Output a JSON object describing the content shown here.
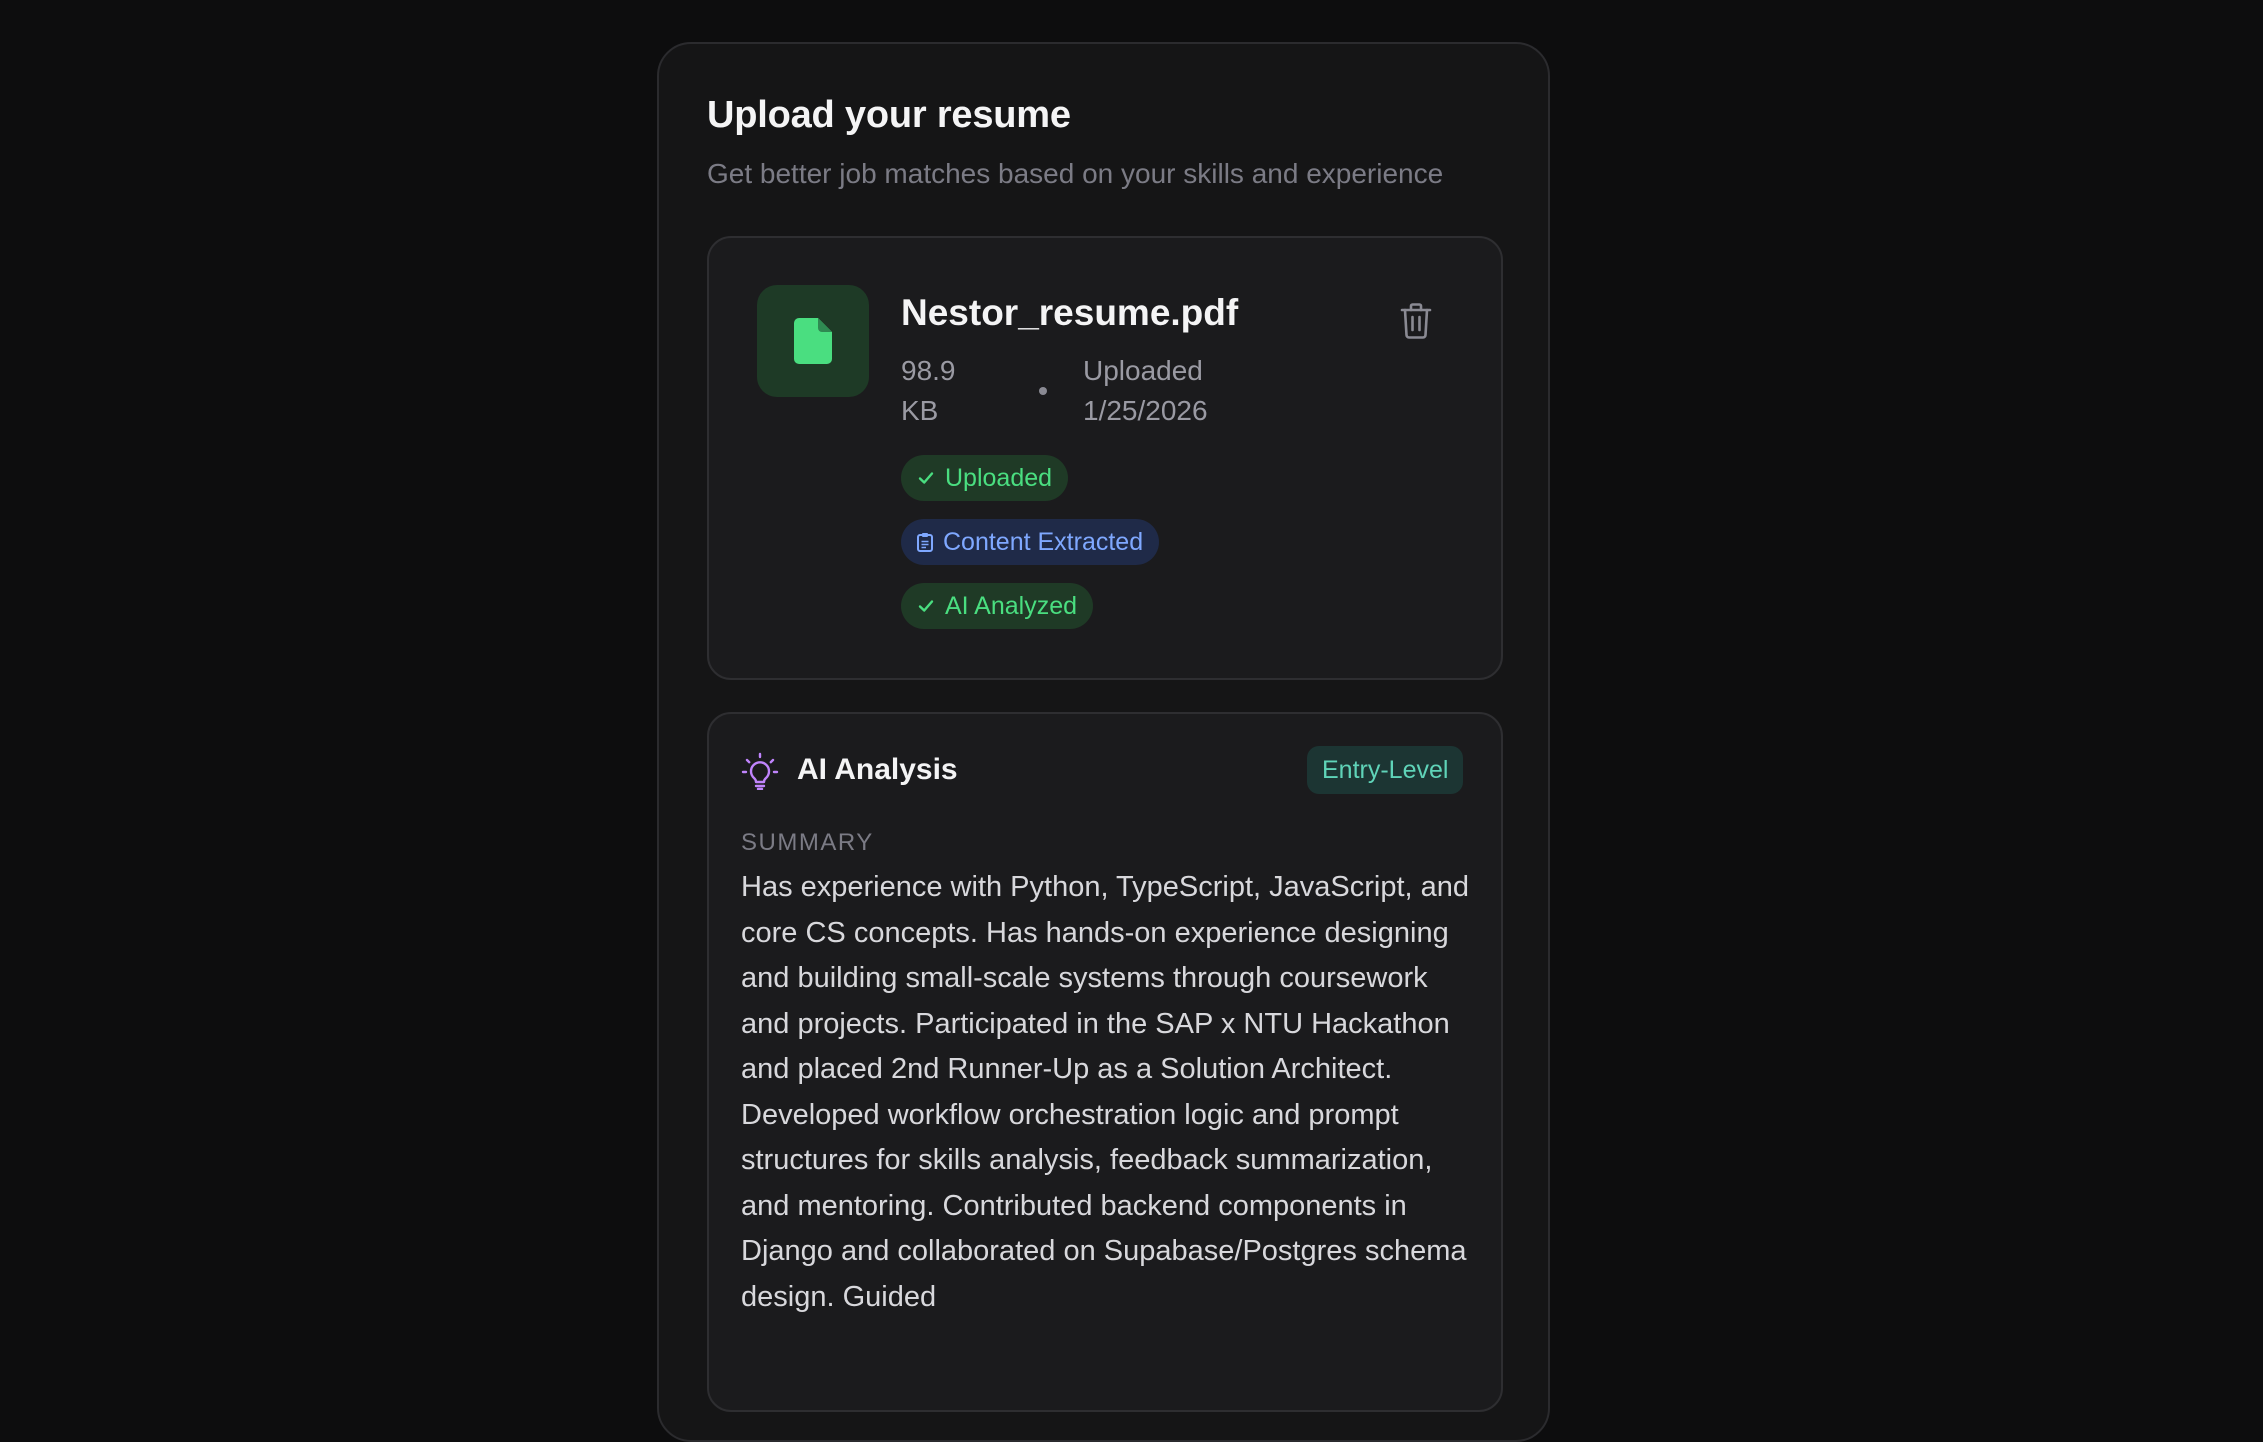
{
  "header": {
    "title": "Upload your resume",
    "subtitle": "Get better job matches based on your skills and experience"
  },
  "file": {
    "icon": "file-icon",
    "name": "Nestor_resume.pdf",
    "size": "98.9 KB",
    "uploaded": "Uploaded 1/25/2026",
    "delete_icon": "trash-icon",
    "badges": [
      {
        "label": "Uploaded",
        "icon": "check-icon",
        "color": "#4ade80"
      },
      {
        "label": "Content Extracted",
        "icon": "clipboard-icon",
        "color": "#7fa8ff"
      },
      {
        "label": "AI Analyzed",
        "icon": "check-icon",
        "color": "#4ade80"
      }
    ]
  },
  "analysis": {
    "icon": "lightbulb-icon",
    "title": "AI Analysis",
    "level": "Entry-Level",
    "summary_label": "SUMMARY",
    "summary": "Has experience with Python, TypeScript, JavaScript, and core CS concepts. Has hands-on experience designing and building small-scale systems through coursework and projects. Participated in the SAP x NTU Hackathon and placed 2nd Runner-Up as a Solution Architect. Developed workflow orchestration logic and prompt structures for skills analysis, feedback summarization, and mentoring. Contributed backend components in Django and collaborated on Supabase/Postgres schema design. Guided"
  },
  "colors": {
    "background": "#0d0d0e",
    "card": "#151516",
    "accent_green": "#4ade80",
    "accent_blue": "#7fa8ff",
    "accent_purple": "#c084fc",
    "accent_teal": "#5fd3b8"
  }
}
